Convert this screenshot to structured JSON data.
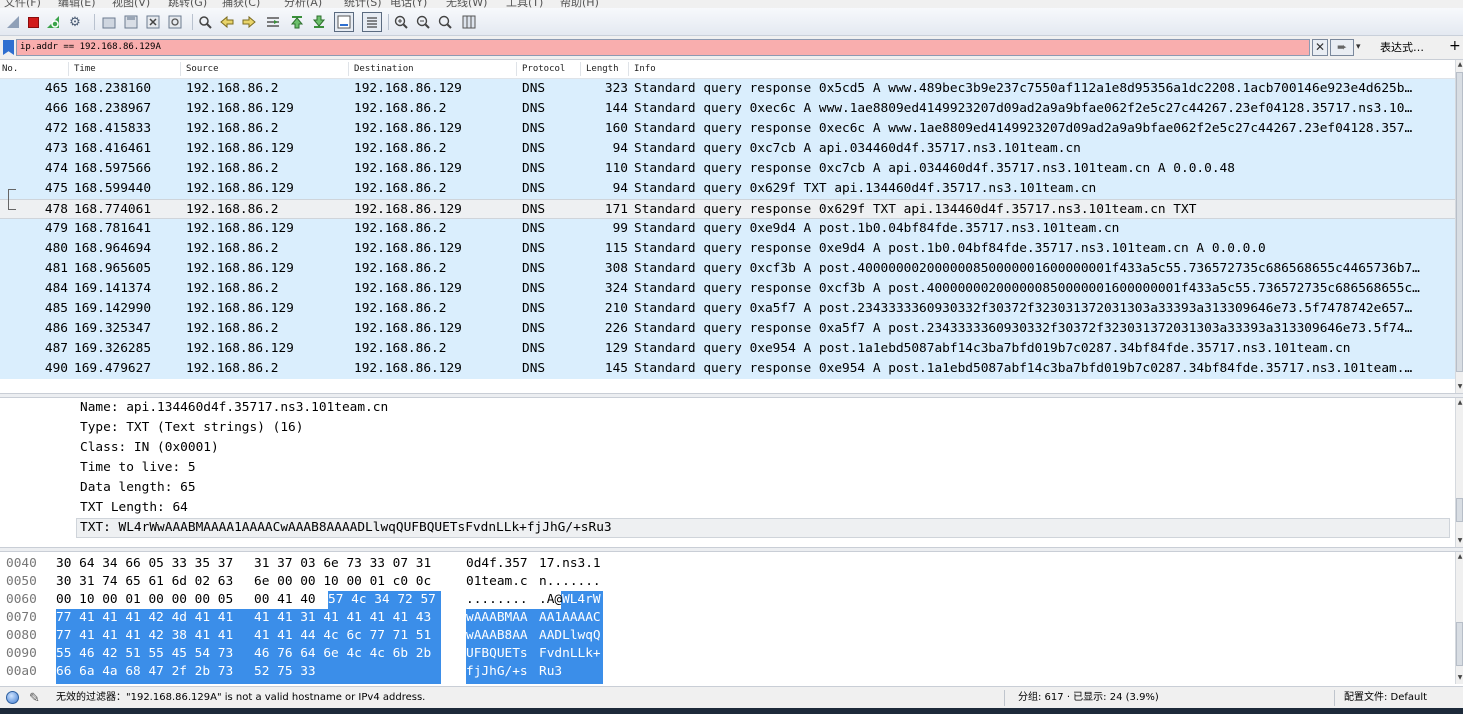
{
  "menu": [
    "文件(F)",
    "编辑(E)",
    "视图(V)",
    "跳转(G)",
    "捕获(C)",
    "分析(A)",
    "统计(S)",
    "电话(Y)",
    "无线(W)",
    "工具(T)",
    "帮助(H)"
  ],
  "filter": {
    "value": "ip.addr == 192.168.86.129A",
    "bg_color": "#f9aeae",
    "expression_label": "表达式…",
    "plus_label": "+"
  },
  "packet_list": {
    "columns": [
      "No.",
      "Time",
      "Source",
      "Destination",
      "Protocol",
      "Length",
      "Info"
    ],
    "row_color": "#daeefd",
    "rows": [
      {
        "no": "465",
        "time": "168.238160",
        "src": "192.168.86.2",
        "dst": "192.168.86.129",
        "proto": "DNS",
        "len": "323",
        "info": "Standard query response 0x5cd5 A www.489bec3b9e237c7550af112a1e8d95356a1dc2208.1acb700146e923e4d625b…"
      },
      {
        "no": "466",
        "time": "168.238967",
        "src": "192.168.86.129",
        "dst": "192.168.86.2",
        "proto": "DNS",
        "len": "144",
        "info": "Standard query 0xec6c A www.1ae8809ed4149923207d09ad2a9a9bfae062f2e5c27c44267.23ef04128.35717.ns3.10…"
      },
      {
        "no": "472",
        "time": "168.415833",
        "src": "192.168.86.2",
        "dst": "192.168.86.129",
        "proto": "DNS",
        "len": "160",
        "info": "Standard query response 0xec6c A www.1ae8809ed4149923207d09ad2a9a9bfae062f2e5c27c44267.23ef04128.357…"
      },
      {
        "no": "473",
        "time": "168.416461",
        "src": "192.168.86.129",
        "dst": "192.168.86.2",
        "proto": "DNS",
        "len": "94",
        "info": "Standard query 0xc7cb A api.034460d4f.35717.ns3.101team.cn"
      },
      {
        "no": "474",
        "time": "168.597566",
        "src": "192.168.86.2",
        "dst": "192.168.86.129",
        "proto": "DNS",
        "len": "110",
        "info": "Standard query response 0xc7cb A api.034460d4f.35717.ns3.101team.cn A 0.0.0.48"
      },
      {
        "no": "475",
        "time": "168.599440",
        "src": "192.168.86.129",
        "dst": "192.168.86.2",
        "proto": "DNS",
        "len": "94",
        "info": "Standard query 0x629f TXT api.134460d4f.35717.ns3.101team.cn"
      },
      {
        "no": "478",
        "time": "168.774061",
        "src": "192.168.86.2",
        "dst": "192.168.86.129",
        "proto": "DNS",
        "len": "171",
        "info": "Standard query response 0x629f TXT api.134460d4f.35717.ns3.101team.cn TXT",
        "selected": true
      },
      {
        "no": "479",
        "time": "168.781641",
        "src": "192.168.86.129",
        "dst": "192.168.86.2",
        "proto": "DNS",
        "len": "99",
        "info": "Standard query 0xe9d4 A post.1b0.04bf84fde.35717.ns3.101team.cn"
      },
      {
        "no": "480",
        "time": "168.964694",
        "src": "192.168.86.2",
        "dst": "192.168.86.129",
        "proto": "DNS",
        "len": "115",
        "info": "Standard query response 0xe9d4 A post.1b0.04bf84fde.35717.ns3.101team.cn A 0.0.0.0"
      },
      {
        "no": "481",
        "time": "168.965605",
        "src": "192.168.86.129",
        "dst": "192.168.86.2",
        "proto": "DNS",
        "len": "308",
        "info": "Standard query 0xcf3b A post.400000002000000850000001600000001f433a5c55.736572735c686568655c4465736b7…"
      },
      {
        "no": "484",
        "time": "169.141374",
        "src": "192.168.86.2",
        "dst": "192.168.86.129",
        "proto": "DNS",
        "len": "324",
        "info": "Standard query response 0xcf3b A post.400000002000000850000001600000001f433a5c55.736572735c686568655c…"
      },
      {
        "no": "485",
        "time": "169.142990",
        "src": "192.168.86.129",
        "dst": "192.168.86.2",
        "proto": "DNS",
        "len": "210",
        "info": "Standard query 0xa5f7 A post.2343333360930332f30372f323031372031303a33393a313309646e73.5f7478742e657…"
      },
      {
        "no": "486",
        "time": "169.325347",
        "src": "192.168.86.2",
        "dst": "192.168.86.129",
        "proto": "DNS",
        "len": "226",
        "info": "Standard query response 0xa5f7 A post.2343333360930332f30372f323031372031303a33393a313309646e73.5f74…"
      },
      {
        "no": "487",
        "time": "169.326285",
        "src": "192.168.86.129",
        "dst": "192.168.86.2",
        "proto": "DNS",
        "len": "129",
        "info": "Standard query 0xe954 A post.1a1ebd5087abf14c3ba7bfd019b7c0287.34bf84fde.35717.ns3.101team.cn"
      },
      {
        "no": "490",
        "time": "169.479627",
        "src": "192.168.86.2",
        "dst": "192.168.86.129",
        "proto": "DNS",
        "len": "145",
        "info": "Standard query response 0xe954 A post.1a1ebd5087abf14c3ba7bfd019b7c0287.34bf84fde.35717.ns3.101team.…"
      }
    ]
  },
  "details": {
    "lines": [
      "Name: api.134460d4f.35717.ns3.101team.cn",
      "Type: TXT (Text strings) (16)",
      "Class: IN (0x0001)",
      "Time to live: 5",
      "Data length: 65",
      "TXT Length: 64",
      "TXT: WL4rWwAAABMAAAA1AAAACwAAAB8AAAADLlwqQUFBQUETsFvdnLLk+fjJhG/+sRu3"
    ]
  },
  "bytes": {
    "rows": [
      {
        "off": "0040",
        "hex1": "30 64 34 66 05 33 35 37",
        "hex2": "31 37 03 6e 73 33 07 31",
        "asc1": "0d4f.357",
        "asc2": "17.ns3.1"
      },
      {
        "off": "0050",
        "hex1": "30 31 74 65 61 6d 02 63",
        "hex2": "6e 00 00 10 00 01 c0 0c",
        "asc1": "01team.c",
        "asc2": "n......."
      },
      {
        "off": "0060",
        "hex1": "00 10 00 01 00 00 00 05",
        "hex2": "00 41 40 57 4c 34 72 57",
        "asc1": "........",
        "asc2": ".A@WL4rW"
      },
      {
        "off": "0070",
        "hex1": "77 41 41 41 42 4d 41 41",
        "hex2": "41 41 31 41 41 41 41 43",
        "asc1": "wAAABMAA",
        "asc2": "AA1AAAAC"
      },
      {
        "off": "0080",
        "hex1": "77 41 41 41 42 38 41 41",
        "hex2": "41 41 44 4c 6c 77 71 51",
        "asc1": "wAAAB8AA",
        "asc2": "AADLlwqQ"
      },
      {
        "off": "0090",
        "hex1": "55 46 42 51 55 45 54 73",
        "hex2": "46 76 64 6e 4c 4c 6b 2b",
        "asc1": "UFBQUETs",
        "asc2": "FvdnLLk+"
      },
      {
        "off": "00a0",
        "hex1": "66 6a 4a 68 47 2f 2b 73",
        "hex2": "52 75 33",
        "asc1": "fjJhG/+s",
        "asc2": "Ru3"
      }
    ],
    "highlight_color": "#3b8ee9"
  },
  "status": {
    "message": "无效的过滤器：\"192.168.86.129A\" is not a valid hostname or IPv4 address.",
    "stats": "分组: 617 · 已显示: 24 (3.9%)",
    "profile": "配置文件: Default"
  }
}
